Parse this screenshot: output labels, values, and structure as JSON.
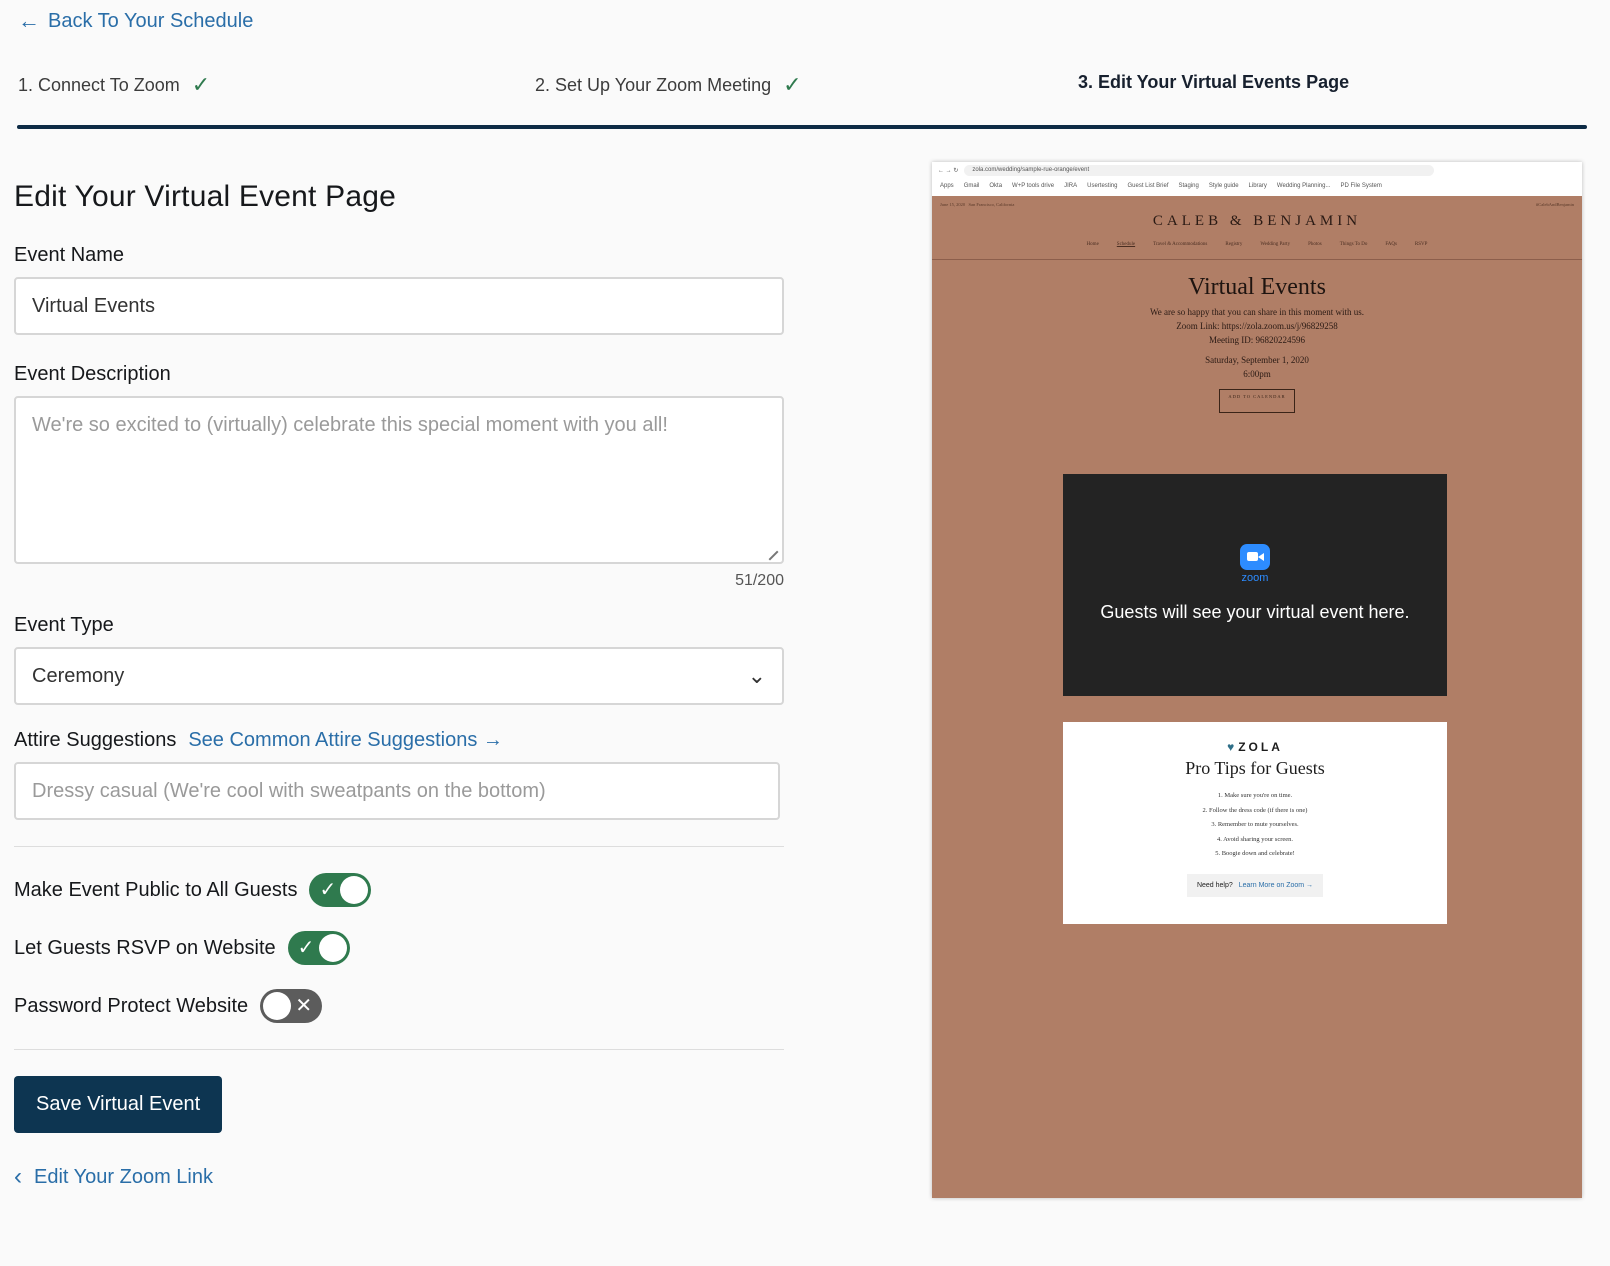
{
  "nav": {
    "back_label": "Back To Your Schedule"
  },
  "steps": [
    {
      "label": "1. Connect To Zoom",
      "done": true
    },
    {
      "label": "2. Set Up Your Zoom Meeting",
      "done": true
    },
    {
      "label": "3. Edit Your Virtual Events Page",
      "done": false
    }
  ],
  "form": {
    "title": "Edit Your Virtual Event Page",
    "event_name_label": "Event Name",
    "event_name_value": "Virtual Events",
    "event_description_label": "Event Description",
    "event_description_placeholder": "We're so excited to (virtually) celebrate this special moment with you all!",
    "char_counter": "51/200",
    "event_type_label": "Event Type",
    "event_type_value": "Ceremony",
    "attire_label": "Attire Suggestions",
    "attire_link": "See Common Attire Suggestions →",
    "attire_placeholder": "Dressy casual (We're cool with sweatpants on the bottom)",
    "toggles": [
      {
        "label": "Make Event Public to All Guests",
        "on": true
      },
      {
        "label": "Let Guests RSVP on Website",
        "on": true
      },
      {
        "label": "Password Protect Website",
        "on": false
      }
    ],
    "save_label": "Save Virtual Event",
    "edit_zoom_label": "Edit Your Zoom Link"
  },
  "icons": {
    "back": "arrow-left-icon",
    "check": "checkmark-icon",
    "dropdown": "chevron-down-icon",
    "edit_zoom": "chevron-left-icon"
  },
  "colors": {
    "link": "#2a6ea8",
    "primary": "#0d3551",
    "toggle_on": "#2f7a4e",
    "preview_bg": "#b07e66"
  },
  "preview": {
    "url": "zola.com/wedding/sample-rue-orange/event",
    "bookmarks": [
      "Apps",
      "Gmail",
      "Okta",
      "W+P tools drive",
      "JIRA",
      "Usertesting",
      "Guest List Brief",
      "Staging",
      "Style guide",
      "Library",
      "Wedding Planning...",
      "PD File System"
    ],
    "site_date": "June 15, 2020",
    "site_location": "San Francisco, California",
    "site_hashtag": "#CalebAndBenjamin",
    "couple": "CALEB & BENJAMIN",
    "site_nav": [
      "Home",
      "Schedule",
      "Travel & Accommodations",
      "Registry",
      "Wedding Party",
      "Photos",
      "Things To Do",
      "FAQs",
      "RSVP"
    ],
    "title": "Virtual Events",
    "line1": "We are so happy that you can share in this moment with us.",
    "zoom_link": "Zoom Link: https://zola.zoom.us/j/96829258",
    "meeting_id": "Meeting ID: 96820224596",
    "date": "Saturday, September 1, 2020",
    "time": "6:00pm",
    "calendar_btn": "ADD TO CALENDAR",
    "zoom_word": "zoom",
    "zoom_msg": "Guests will see your virtual event here.",
    "zola": "ZOLA",
    "tips_title": "Pro Tips for Guests",
    "tips": [
      "1. Make sure you're on time.",
      "2. Follow the dress code (if there is one)",
      "3. Remember to mute yourselves.",
      "4. Avoid sharing your screen.",
      "5. Boogie down and celebrate!"
    ],
    "need_help": "Need help?",
    "learn_more": "Learn More on Zoom →"
  }
}
